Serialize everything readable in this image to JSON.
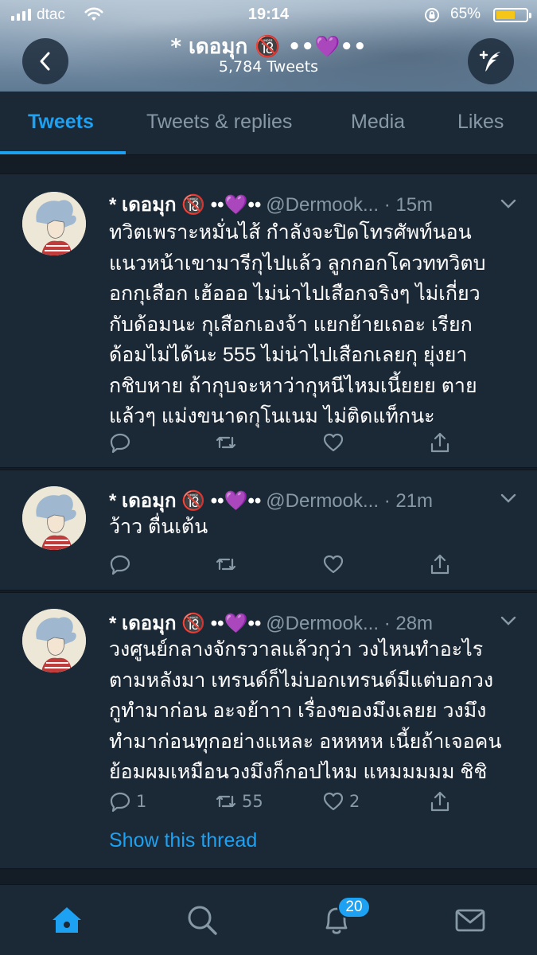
{
  "status_bar": {
    "carrier": "dtac",
    "time": "19:14",
    "battery_percent": "65%",
    "battery_level": 0.65
  },
  "header": {
    "title": "* เดอมุก 🔞 ••💜••",
    "subtitle": "5,784 Tweets"
  },
  "tabs": [
    {
      "label": "Tweets",
      "active": true
    },
    {
      "label": "Tweets & replies",
      "active": false
    },
    {
      "label": "Media",
      "active": false
    },
    {
      "label": "Likes",
      "active": false
    }
  ],
  "tweets": [
    {
      "name": "* เดอมุก 🔞 ••💜••",
      "handle": "@Dermook...",
      "time": "· 15m",
      "text": "ทวิตเพราะหมั่นไส้ กำลังจะปิดโทรศัพท์นอน\nแนวหน้าเขามารีกุไปแล้ว ลูกกอกโควททวิตบ\nอกกุเสือก เฮ้อออ ไม่น่าไปเสือกจริงๆ ไม่เกี่ยว\nกับด้อมนะ กุเสือกเองจ้า แยกย้ายเถอะ เรียก\nด้อมไม่ได้นะ 555 ไม่น่าไปเสือกเลยกุ ยุ่งยา\nกชิบหาย ถ้ากุบจะหาว่ากุหนีไหมเนี้ยยย ตาย\nแล้วๆ แม่งขนาดกุโนเนม ไม่ติดแท็กนะ",
      "replies": "",
      "retweets": "",
      "likes": ""
    },
    {
      "name": "* เดอมุก 🔞 ••💜••",
      "handle": "@Dermook...",
      "time": "· 21m",
      "text": "ว้าว ตื่นเต้น",
      "replies": "",
      "retweets": "",
      "likes": ""
    },
    {
      "name": "* เดอมุก 🔞 ••💜••",
      "handle": "@Dermook...",
      "time": "· 28m",
      "text": "วงศูนย์กลางจักรวาลแล้วกุว่า วงไหนทำอะไร\nตามหลังมา เทรนด์ก็ไม่บอกเทรนด์มีแต่บอกวง\nกูทำมาก่อน อะจย้าาา เรื่องของมึงเลยย วงมึง\nทำมาก่อนทุกอย่างแหละ อหหหห เนี้ยถ้าเจอคน\nย้อมผมเหมือนวงมึงก็กอปไหม แหมมมมม ชิชิ",
      "replies": "1",
      "retweets": "55",
      "likes": "2",
      "show_thread": "Show this thread"
    }
  ],
  "bottom_nav": {
    "items": [
      "home-icon",
      "search-icon",
      "notifications-icon",
      "messages-icon"
    ],
    "notification_badge": "20"
  },
  "colors": {
    "accent": "#1da1f2",
    "background": "#141d26",
    "card": "#1b2836",
    "muted": "#8899a6"
  }
}
